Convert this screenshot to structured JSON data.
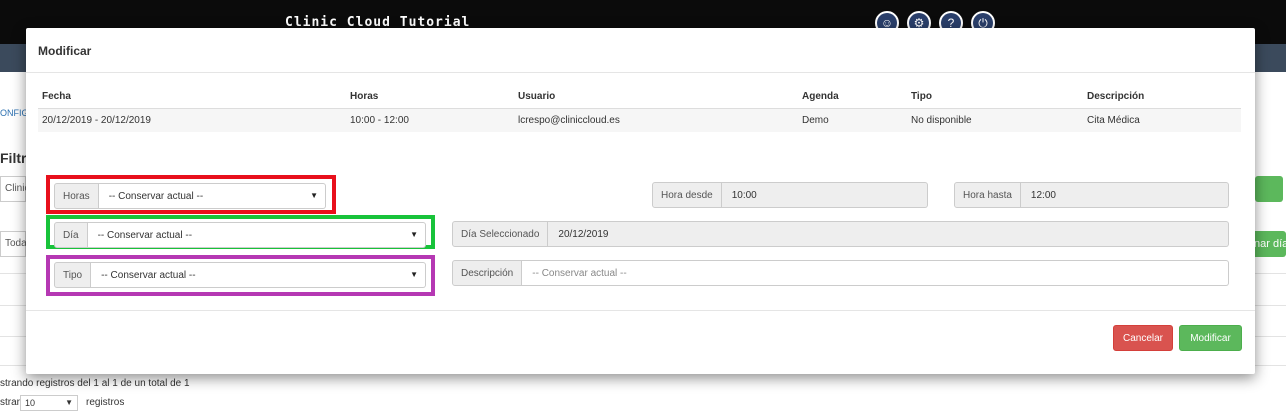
{
  "app": {
    "title": "Clinic Cloud Tutorial",
    "icons": [
      "user-icon",
      "gear-icon",
      "help-icon",
      "power-icon"
    ]
  },
  "background": {
    "breadcrumb": "ONFIGU",
    "filter_heading": "Filtra",
    "clinic_field": "Clinic",
    "todas_field": "Todas",
    "green_button_partial": "nar días",
    "records_text": "strando registros del 1 al 1 de un total de 1",
    "show_label": "strar",
    "page_size": "10",
    "records_suffix": "registros"
  },
  "modal": {
    "title": "Modificar",
    "table": {
      "headers": [
        "Fecha",
        "Horas",
        "Usuario",
        "Agenda",
        "Tipo",
        "Descripción"
      ],
      "row": [
        "20/12/2019 - 20/12/2019",
        "10:00 - 12:00",
        "lcrespo@cliniccloud.es",
        "Demo",
        "No disponible",
        "Cita Médica"
      ]
    },
    "form": {
      "horas_label": "Horas",
      "horas_value": "-- Conservar actual --",
      "dia_label": "Día",
      "dia_value": "-- Conservar actual --",
      "tipo_label": "Tipo",
      "tipo_value": "-- Conservar actual --",
      "hora_desde_label": "Hora desde",
      "hora_desde_value": "10:00",
      "hora_hasta_label": "Hora hasta",
      "hora_hasta_value": "12:00",
      "dia_sel_label": "Día Seleccionado",
      "dia_sel_value": "20/12/2019",
      "descripcion_label": "Descripción",
      "descripcion_placeholder": "-- Conservar actual --"
    },
    "buttons": {
      "cancel": "Cancelar",
      "ok": "Modificar"
    }
  },
  "colors": {
    "highlight_horas": "#e8101c",
    "highlight_dia": "#18c33a",
    "highlight_tipo": "#b538b3",
    "cancel": "#d9534f",
    "ok": "#5cb85c"
  }
}
